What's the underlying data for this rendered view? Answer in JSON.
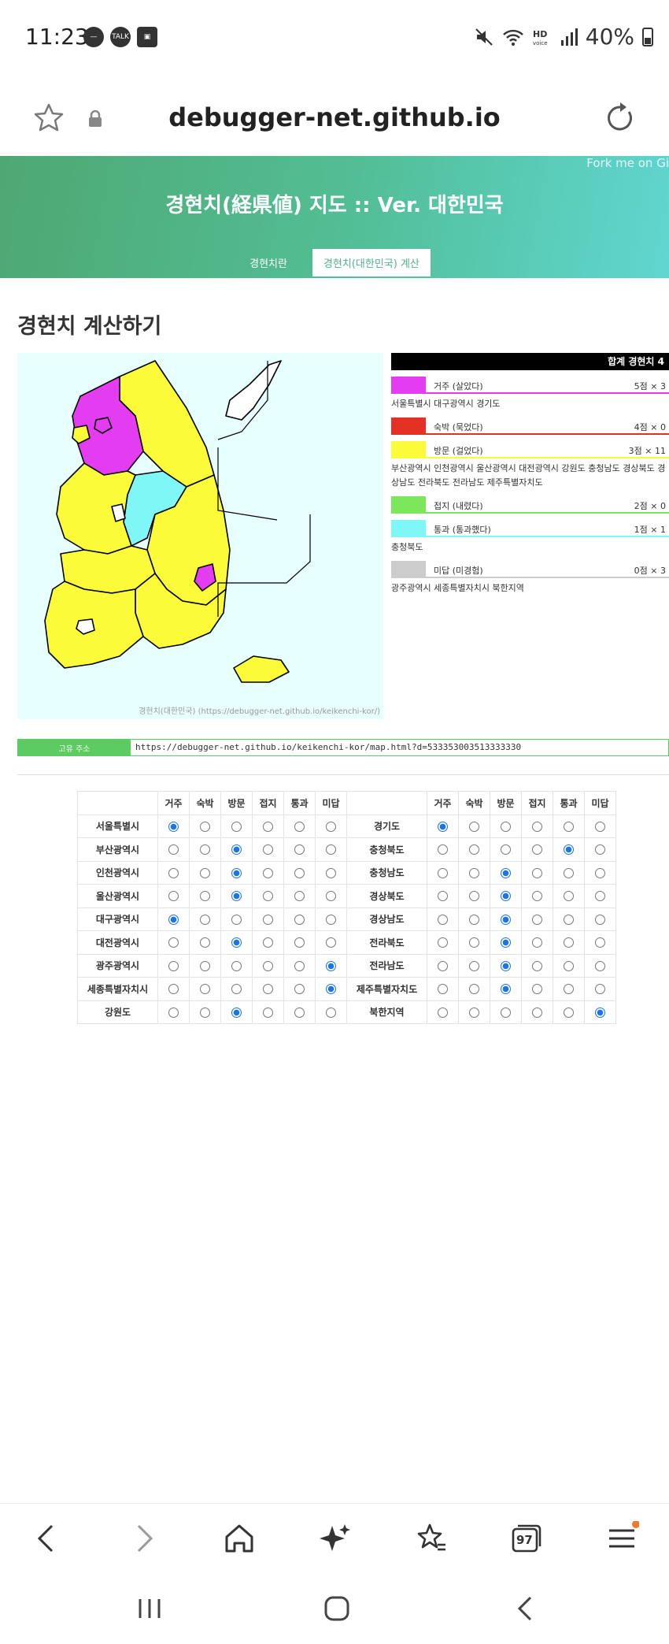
{
  "status": {
    "time": "11:23",
    "battery": "40%"
  },
  "browser": {
    "url": "debugger-net.github.io"
  },
  "hero": {
    "fork_text": "Fork me on Gi",
    "title": "경현치(経県値) 지도 :: Ver. 대한민국",
    "tabs": [
      "경현치란",
      "경현치(대한민국) 계산"
    ]
  },
  "section_title": "경현치 계산하기",
  "map": {
    "caption": "경현치(대한민국) (https://debugger-net.github.io/keikenchi-kor/)"
  },
  "legend": {
    "header": "합계 경현치 4",
    "rows": [
      {
        "name": "거주 (살았다)",
        "score": "5점 × 3",
        "color": "#e43cf0",
        "regions": "서울특별시  대구광역시  경기도"
      },
      {
        "name": "숙박 (묵었다)",
        "score": "4점 × 0",
        "color": "#e33126",
        "regions": ""
      },
      {
        "name": "방문 (걸었다)",
        "score": "3점 × 11",
        "color": "#fbfb3a",
        "regions": "부산광역시  인천광역시  울산광역시  대전광역시  강원도  충청남도  경상북도  경상남도  전라북도  전라남도  제주특별자치도"
      },
      {
        "name": "접지 (내렸다)",
        "score": "2점 × 0",
        "color": "#7ce75b",
        "regions": ""
      },
      {
        "name": "통과 (통과했다)",
        "score": "1점 × 1",
        "color": "#7ff7f7",
        "regions": "충청북도"
      },
      {
        "name": "미답 (미경험)",
        "score": "0점 × 3",
        "color": "#cccccc",
        "regions": "광주광역시  세종특별자치시  북한지역"
      }
    ]
  },
  "permalink": {
    "label": "고유 주소",
    "url": "https://debugger-net.github.io/keikenchi-kor/map.html?d=533353003513333330"
  },
  "table": {
    "columns": [
      "거주",
      "숙박",
      "방문",
      "접지",
      "통과",
      "미답"
    ],
    "left": [
      {
        "name": "서울특별시",
        "sel": 0
      },
      {
        "name": "부산광역시",
        "sel": 2
      },
      {
        "name": "인천광역시",
        "sel": 2
      },
      {
        "name": "울산광역시",
        "sel": 2
      },
      {
        "name": "대구광역시",
        "sel": 0
      },
      {
        "name": "대전광역시",
        "sel": 2
      },
      {
        "name": "광주광역시",
        "sel": 5
      },
      {
        "name": "세종특별자치시",
        "sel": 5
      },
      {
        "name": "강원도",
        "sel": 2
      }
    ],
    "right": [
      {
        "name": "경기도",
        "sel": 0
      },
      {
        "name": "충청북도",
        "sel": 4
      },
      {
        "name": "충청남도",
        "sel": 2
      },
      {
        "name": "경상북도",
        "sel": 2
      },
      {
        "name": "경상남도",
        "sel": 2
      },
      {
        "name": "전라북도",
        "sel": 2
      },
      {
        "name": "전라남도",
        "sel": 2
      },
      {
        "name": "제주특별자치도",
        "sel": 2
      },
      {
        "name": "북한지역",
        "sel": 5
      }
    ]
  },
  "bottom_nav": {
    "tab_count": "97"
  }
}
